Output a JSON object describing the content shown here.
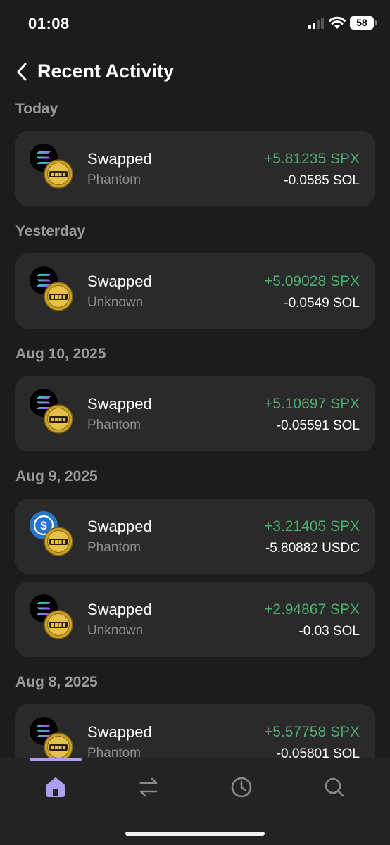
{
  "status_bar": {
    "time": "01:08",
    "battery": "58"
  },
  "header": {
    "title": "Recent Activity"
  },
  "colors": {
    "gain": "#4caf72",
    "accent": "#ab9ff2",
    "card": "#2a2a2a",
    "background": "#1c1c1c"
  },
  "sections": [
    {
      "label": "Today",
      "items": [
        {
          "title": "Swapped",
          "source": "Phantom",
          "gain": "+5.81235 SPX",
          "loss": "-0.0585 SOL",
          "from_icon": "solana-icon",
          "to_icon": "spx-coin-icon"
        }
      ]
    },
    {
      "label": "Yesterday",
      "items": [
        {
          "title": "Swapped",
          "source": "Unknown",
          "gain": "+5.09028 SPX",
          "loss": "-0.0549 SOL",
          "from_icon": "solana-icon",
          "to_icon": "spx-coin-icon"
        }
      ]
    },
    {
      "label": "Aug 10, 2025",
      "items": [
        {
          "title": "Swapped",
          "source": "Phantom",
          "gain": "+5.10697 SPX",
          "loss": "-0.05591 SOL",
          "from_icon": "solana-icon",
          "to_icon": "spx-coin-icon"
        }
      ]
    },
    {
      "label": "Aug 9, 2025",
      "items": [
        {
          "title": "Swapped",
          "source": "Phantom",
          "gain": "+3.21405 SPX",
          "loss": "-5.80882 USDC",
          "from_icon": "usdc-icon",
          "to_icon": "spx-coin-icon"
        },
        {
          "title": "Swapped",
          "source": "Unknown",
          "gain": "+2.94867 SPX",
          "loss": "-0.03 SOL",
          "from_icon": "solana-icon",
          "to_icon": "spx-coin-icon"
        }
      ]
    },
    {
      "label": "Aug 8, 2025",
      "items": [
        {
          "title": "Swapped",
          "source": "Phantom",
          "gain": "+5.57758 SPX",
          "loss": "-0.05801 SOL",
          "from_icon": "solana-icon",
          "to_icon": "spx-coin-icon"
        }
      ]
    }
  ],
  "tabs": [
    {
      "name": "home",
      "icon": "home-icon",
      "active": true
    },
    {
      "name": "swap",
      "icon": "swap-icon",
      "active": false
    },
    {
      "name": "activity",
      "icon": "clock-icon",
      "active": false
    },
    {
      "name": "search",
      "icon": "search-icon",
      "active": false
    }
  ]
}
